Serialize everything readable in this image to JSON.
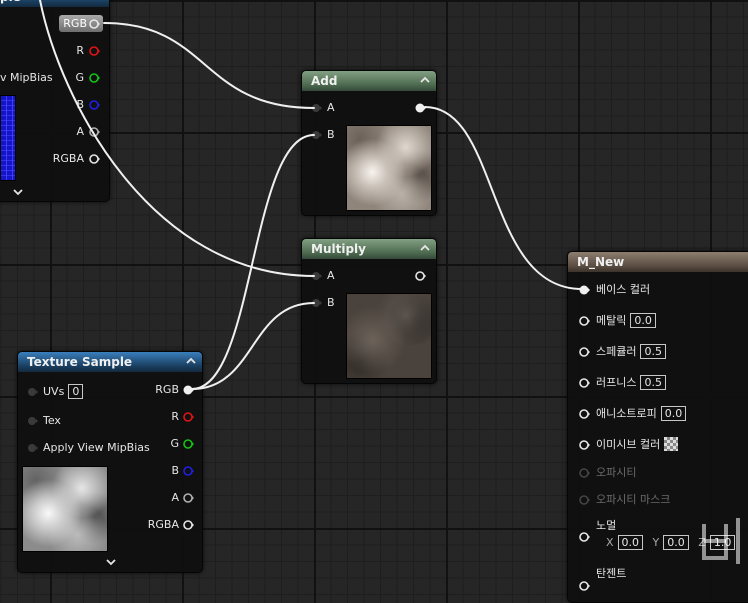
{
  "colors": {
    "pin_white": "#e6e6e6",
    "pin_red": "#e01414",
    "pin_green": "#16c416",
    "pin_blue": "#1f1fe8",
    "pin_gray": "#b0b0b0",
    "wire": "#f0f0f0"
  },
  "tex_top": {
    "header_fragment": "ple",
    "rgb_label": "RGB",
    "r_label": "R",
    "g_label": "G",
    "b_label": "B",
    "a_label": "A",
    "rgba_label": "RGBA",
    "mipbias_fragment": "v MipBias"
  },
  "add_node": {
    "title": "Add",
    "pin_a": "A",
    "pin_b": "B"
  },
  "multiply_node": {
    "title": "Multiply",
    "pin_a": "A",
    "pin_b": "B"
  },
  "texture_sample": {
    "title": "Texture Sample",
    "uvs_label": "UVs",
    "uvs_value": "0",
    "tex_label": "Tex",
    "mipbias_label": "Apply View MipBias",
    "rgb_label": "RGB",
    "r_label": "R",
    "g_label": "G",
    "b_label": "B",
    "a_label": "A",
    "rgba_label": "RGBA"
  },
  "material": {
    "title": "M_New",
    "base_color": "베이스 컬러",
    "metallic_label": "메탈릭",
    "metallic_value": "0.0",
    "specular_label": "스페큘러",
    "specular_value": "0.5",
    "roughness_label": "러프니스",
    "roughness_value": "0.5",
    "anisotropy_label": "애니소트로피",
    "anisotropy_value": "0.0",
    "emissive_label": "이미시브 컬러",
    "opacity_label": "오파시티",
    "opacity_mask_label": "오파시티 마스크",
    "normal_label": "노멀",
    "normal_x_label": "X",
    "normal_x": "0.0",
    "normal_y_label": "Y",
    "normal_y": "0.0",
    "normal_z_label": "Z",
    "normal_z": "1.0",
    "tangent_label": "탄젠트"
  },
  "icons": [
    "collapse-chevron-icon",
    "expand-chevron-icon",
    "exec-pin-icon",
    "checker-swatch-icon",
    "watermark-logo-icon"
  ]
}
